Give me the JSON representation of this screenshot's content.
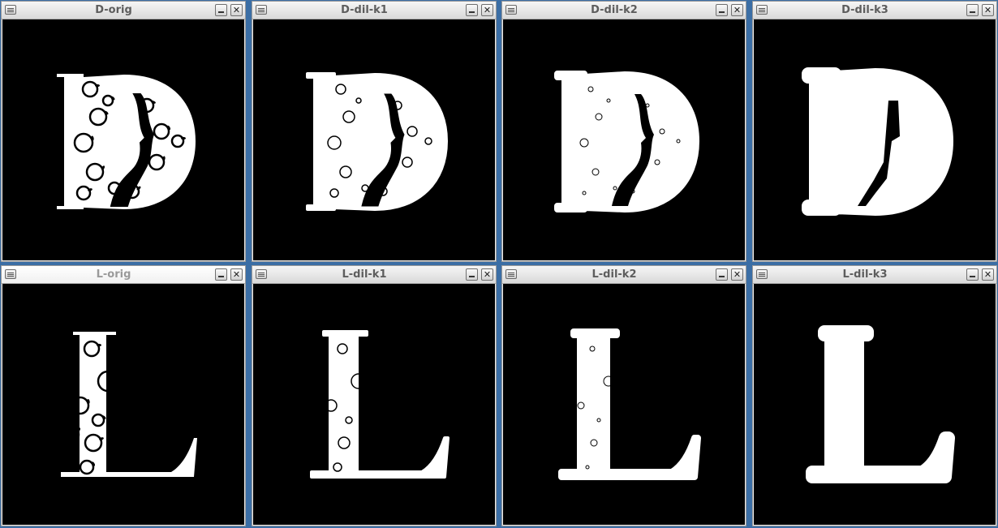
{
  "windows": [
    {
      "title": "D-orig",
      "letter": "D",
      "dilation": 0
    },
    {
      "title": "D-dil-k1",
      "letter": "D",
      "dilation": 1
    },
    {
      "title": "D-dil-k2",
      "letter": "D",
      "dilation": 2
    },
    {
      "title": "D-dil-k3",
      "letter": "D",
      "dilation": 3
    },
    {
      "title": "L-orig",
      "letter": "L",
      "dilation": 0
    },
    {
      "title": "L-dil-k1",
      "letter": "L",
      "dilation": 1
    },
    {
      "title": "L-dil-k2",
      "letter": "L",
      "dilation": 2
    },
    {
      "title": "L-dil-k3",
      "letter": "L",
      "dilation": 3
    }
  ],
  "controls": {
    "close_glyph": "✕",
    "menu_icon": "window-menu-icon",
    "minimize_icon": "minimize-icon",
    "close_icon": "close-icon"
  },
  "colors": {
    "desktop": "#3b6ea5",
    "image_background": "#000000",
    "glyph": "#ffffff"
  }
}
